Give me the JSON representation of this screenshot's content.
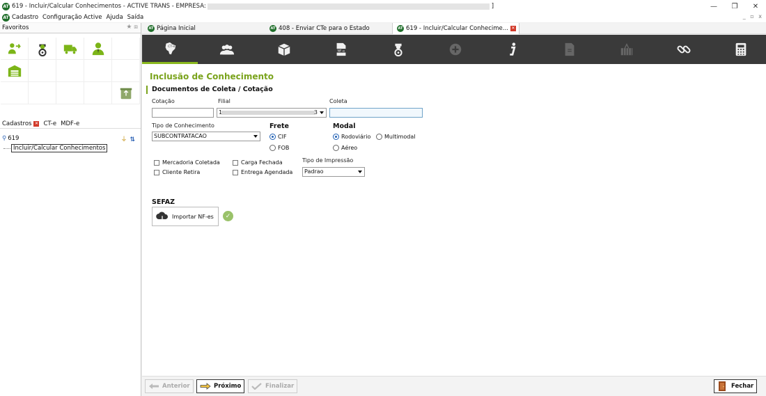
{
  "window": {
    "title": "619 - Incluir/Calcular Conhecimentos - ACTIVE TRANS - EMPRESA: ",
    "cursor_glyph": "]",
    "minimize_glyph": "—",
    "restore_glyph": "❐",
    "close_glyph": "✕",
    "logo_text": "AT"
  },
  "menu": {
    "items": [
      "Cadastro",
      "Configuração Active",
      "Ajuda",
      "Saída"
    ],
    "mdi_controls": "_ ▫ x"
  },
  "left_panel": {
    "favorites_label": "Favoritos",
    "favorites_tools": "★ ⧈",
    "favorite_icons": [
      "user-arrow-icon",
      "driver-icon",
      "truck-icon",
      "person-icon",
      "warehouse-icon",
      "recycle-bin-icon"
    ],
    "tabs": [
      "Cadastros",
      "CT-e",
      "MDF-e"
    ],
    "search_value": "619",
    "search_glyph": "⚲",
    "clear_glyph": "⏚",
    "sort_glyph": "⇅",
    "tree_item": "Incluir/Calcular Conhecimentos"
  },
  "doc_tabs": [
    {
      "label": "Página Inicial"
    },
    {
      "label": "408 - Enviar CTe para o Estado"
    },
    {
      "label": "619 - Incluir/Calcular Conhecime..."
    }
  ],
  "toolbar_icons": [
    "brazil-map-icon",
    "people-icon",
    "box-icon",
    "nfe-document-icon",
    "driver-icon",
    "plus-circle-icon",
    "info-icon",
    "document-icon",
    "cargo-container-icon",
    "link-icon",
    "calculator-icon"
  ],
  "form": {
    "page_title": "Inclusão de Conhecimento",
    "section_title": "Documentos de Coleta / Cotação",
    "cotacao_label": "Cotação",
    "cotacao_value": "",
    "filial_label": "Filial",
    "filial_value_prefix": "1",
    "filial_value_suffix": "3",
    "coleta_label": "Coleta",
    "coleta_value": "",
    "tipo_conhecimento_label": "Tipo de Conhecimento",
    "tipo_conhecimento_value": "SUBCONTRATACAO",
    "frete_label": "Frete",
    "frete_options": [
      {
        "label": "CIF",
        "selected": true
      },
      {
        "label": "FOB",
        "selected": false
      }
    ],
    "modal_label": "Modal",
    "modal_options": [
      {
        "label": "Rodoviário",
        "selected": true
      },
      {
        "label": "Multimodal",
        "selected": false
      },
      {
        "label": "Aéreo",
        "selected": false
      }
    ],
    "checkboxes": [
      {
        "label": "Mercadoria Coletada",
        "checked": false
      },
      {
        "label": "Cliente Retira",
        "checked": false
      },
      {
        "label": "Carga Fechada",
        "checked": false
      },
      {
        "label": "Entrega Agendada",
        "checked": false
      }
    ],
    "tipo_impressao_label": "Tipo de Impressão",
    "tipo_impressao_value": "Padrao",
    "sefaz_title": "SEFAZ",
    "import_button": "Importar NF-es",
    "ok_glyph": "✓"
  },
  "bottom_bar": {
    "anterior": "Anterior",
    "proximo": "Próximo",
    "finalizar": "Finalizar",
    "fechar": "Fechar"
  },
  "colors": {
    "accent_green": "#7aa31c",
    "toolbar_bg": "#3a3a3a",
    "icon_green": "#7cb518",
    "close_red": "#d23a2a"
  }
}
